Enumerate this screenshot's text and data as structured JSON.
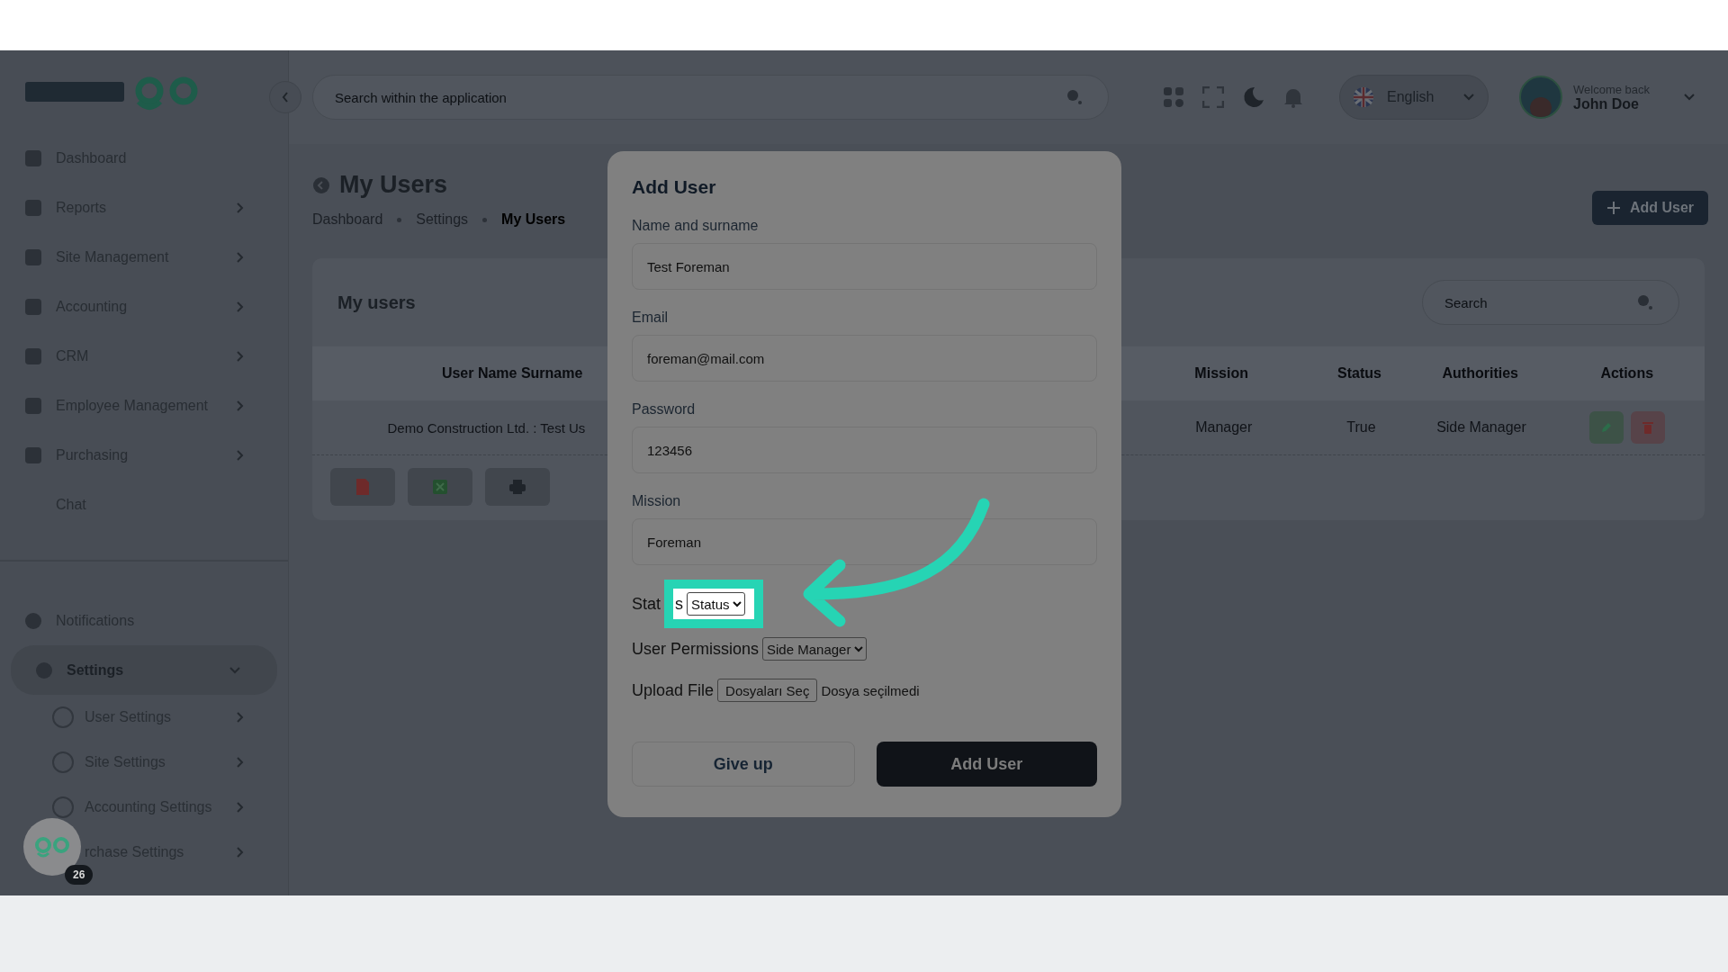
{
  "header": {
    "search": {
      "placeholder": "Search within the application"
    },
    "language": "English",
    "greeting": "Welcome back",
    "user_name": "John Doe"
  },
  "sidebar": {
    "items": [
      {
        "label": "Dashboard",
        "has_icon": true,
        "expandable": false
      },
      {
        "label": "Reports",
        "has_icon": true,
        "expandable": true
      },
      {
        "label": "Site Management",
        "has_icon": true,
        "expandable": true
      },
      {
        "label": "Accounting",
        "has_icon": true,
        "expandable": true
      },
      {
        "label": "CRM",
        "has_icon": true,
        "expandable": true
      },
      {
        "label": "Employee Management",
        "has_icon": true,
        "expandable": true
      },
      {
        "label": "Purchasing",
        "has_icon": true,
        "expandable": true
      },
      {
        "label": "Chat",
        "has_icon": false,
        "expandable": false
      }
    ],
    "bottom_items": [
      {
        "label": "Notifications",
        "selected": false,
        "expanded": false
      },
      {
        "label": "Settings",
        "selected": true,
        "expanded": true,
        "children": [
          {
            "label": "User Settings"
          },
          {
            "label": "Site Settings"
          },
          {
            "label": "Accounting Settings"
          },
          {
            "label": "rchase Settings"
          }
        ]
      }
    ],
    "help_badge": "26"
  },
  "page": {
    "title": "My Users",
    "breadcrumb": [
      {
        "label": "Dashboard",
        "selected": false
      },
      {
        "label": "Settings",
        "selected": false
      },
      {
        "label": "My Users",
        "selected": true
      }
    ],
    "add_button": "Add User"
  },
  "card": {
    "title": "My users",
    "search": {
      "placeholder": "Search"
    },
    "table": {
      "columns": [
        "User Name Surname",
        "Mission",
        "Status",
        "Authorities",
        "Actions"
      ],
      "rows": [
        {
          "user": "Demo Construction Ltd. : Test Us",
          "mission": "Manager",
          "status": "True",
          "authorities": "Side Manager"
        }
      ]
    }
  },
  "modal": {
    "title": "Add User",
    "fields": [
      {
        "label": "Name and surname",
        "value": "Test Foreman"
      },
      {
        "label": "Email",
        "value": "foreman@mail.com"
      },
      {
        "label": "Password",
        "value": "123456"
      },
      {
        "label": "Mission",
        "value": "Foreman"
      }
    ],
    "status_label": [
      "Stat",
      "s"
    ],
    "status_select": "Status",
    "permissions_label": "User Permissions",
    "permissions_select": "Side Manager",
    "upload_label": "Upload File",
    "upload_button": "Dosyaları Seç",
    "upload_status": "Dosya seçilmedi",
    "cancel_button": "Give up",
    "submit_button": "Add User"
  }
}
